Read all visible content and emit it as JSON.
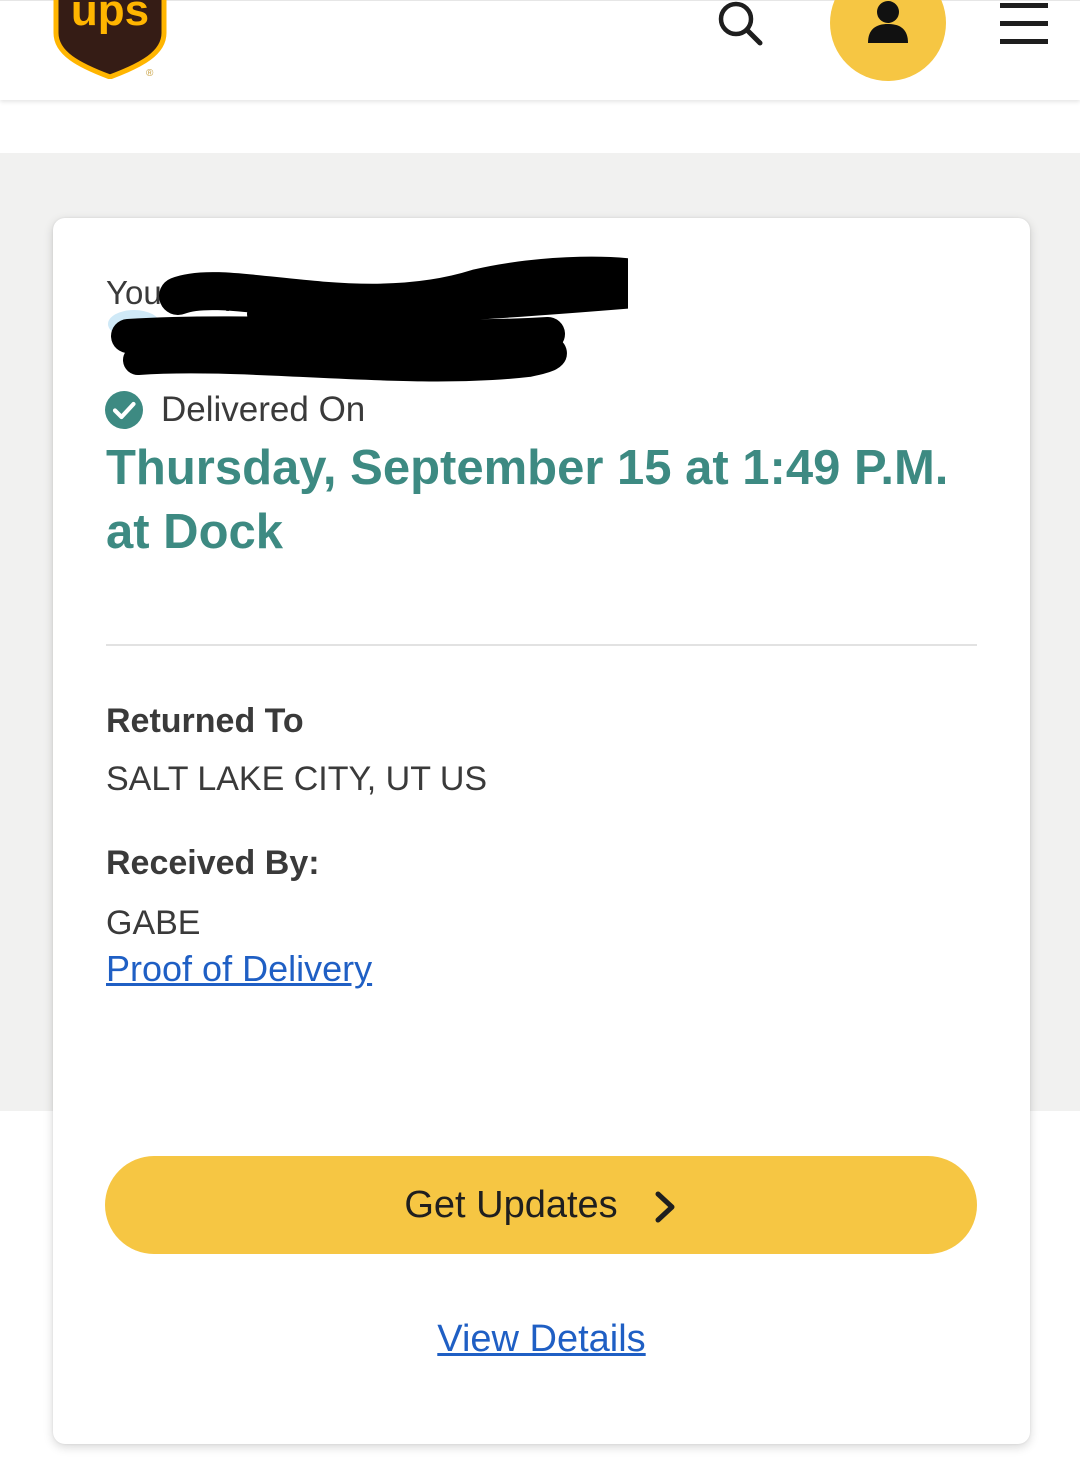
{
  "colors": {
    "brand_brown": "#351c15",
    "brand_gold": "#ffb500",
    "accent_yellow": "#f6c643",
    "success_teal": "#3d8a82",
    "link_blue": "#1f5fc4",
    "page_gray": "#f1f1f0",
    "divider": "#e2e2e2"
  },
  "header": {
    "logo_text": "ups",
    "icons": {
      "search": "search-icon",
      "account": "user-icon",
      "menu": "hamburger-menu-icon"
    }
  },
  "shipment": {
    "label_visible": "Your shipment",
    "tracking_number_redacted": true
  },
  "status": {
    "icon": "check-circle-icon",
    "label": "Delivered On",
    "date_line": "Thursday, September 15 at 1:49 P.M. at Dock"
  },
  "returned_to": {
    "heading": "Returned To",
    "value": "SALT LAKE CITY, UT US"
  },
  "received_by": {
    "heading": "Received By:",
    "value": "GABE"
  },
  "links": {
    "proof_of_delivery": "Proof of Delivery",
    "view_details": "View Details"
  },
  "buttons": {
    "get_updates": "Get Updates",
    "get_updates_icon": "chevron-right-icon"
  }
}
